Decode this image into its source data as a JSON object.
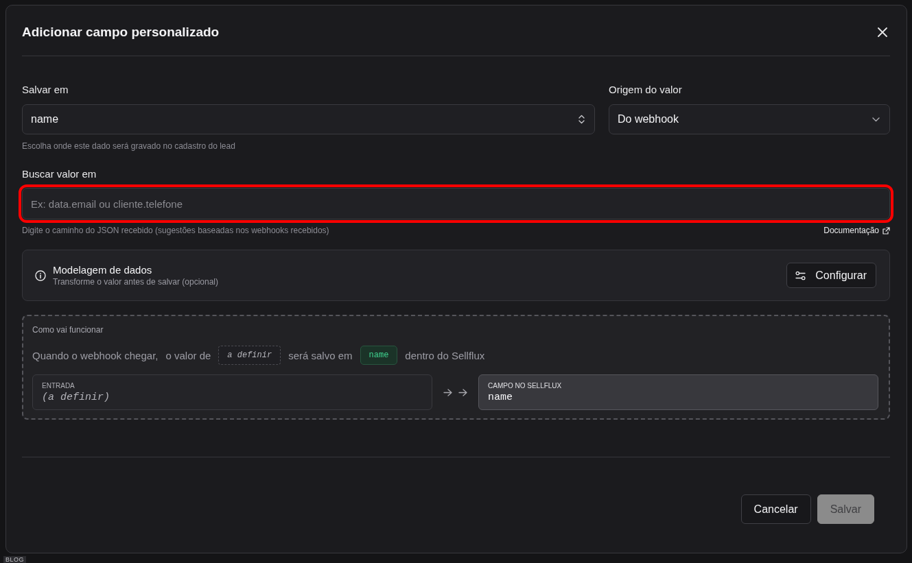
{
  "background_page": {
    "tag": "BLOG"
  },
  "dialog": {
    "title": "Adicionar campo personalizado"
  },
  "save_to": {
    "label": "Salvar em",
    "value": "name",
    "hint": "Escolha onde este dado será gravado no cadastro do lead"
  },
  "value_source": {
    "label": "Origem do valor",
    "value": "Do webhook"
  },
  "lookup": {
    "label": "Buscar valor em",
    "placeholder": "Ex: data.email ou cliente.telefone",
    "highlighted": true,
    "hint": "Digite o caminho do JSON recebido (sugestões baseadas nos webhooks recebidos)",
    "link": "Documentação"
  },
  "data_modeling": {
    "title": "Modelagem de dados",
    "subtitle": "Transforme o valor antes de salvar (opcional)",
    "button": "Configurar"
  },
  "preview": {
    "heading": "Como vai funcionar",
    "sentence": [
      {
        "kind": "text",
        "text": "Quando o webhook chegar,"
      },
      {
        "kind": "text",
        "text": "o valor de"
      },
      {
        "kind": "pending-value",
        "text": "a definir"
      },
      {
        "kind": "text",
        "text": "será salvo em"
      },
      {
        "kind": "field-name",
        "text": "name"
      },
      {
        "kind": "text",
        "text": "dentro do Sellflux"
      }
    ],
    "input": {
      "label": "ENTRADA",
      "value": "(a definir)"
    },
    "output": {
      "label": "CAMPO NO SELLFLUX",
      "value": "name"
    }
  },
  "buttons": [
    {
      "label": "Cancelar",
      "kind": "secondary",
      "disabled": false
    },
    {
      "label": "Salvar",
      "kind": "primary",
      "disabled": true
    }
  ]
}
